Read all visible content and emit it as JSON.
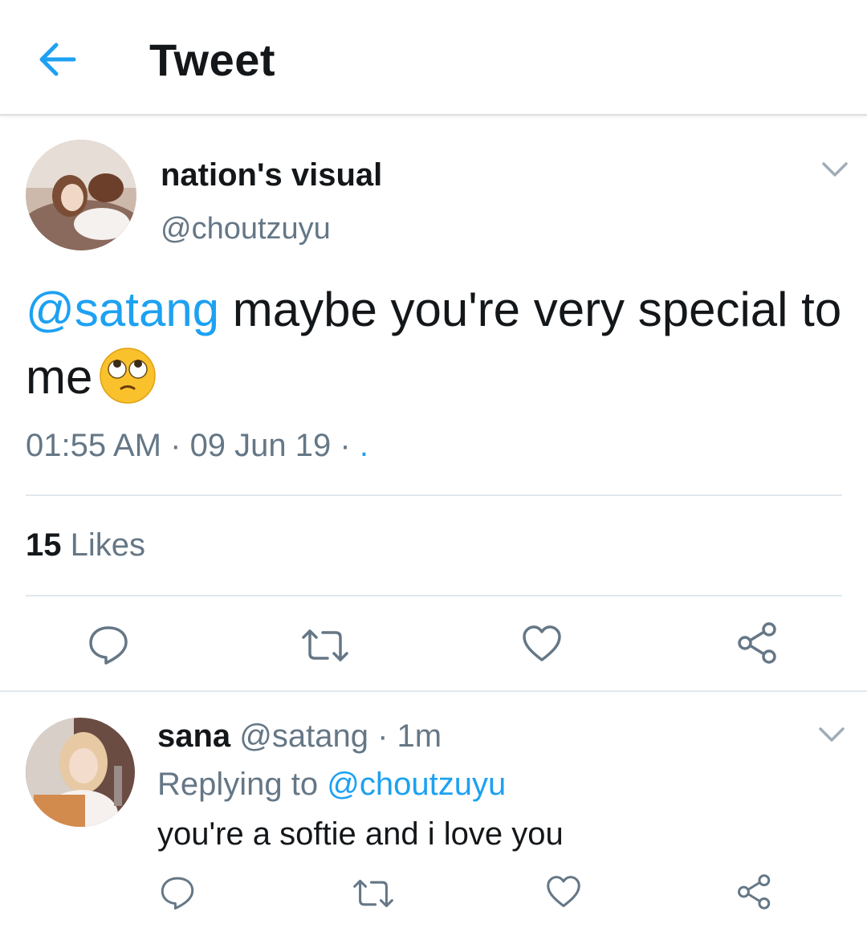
{
  "header": {
    "title": "Tweet",
    "back_icon": "arrow-left-icon"
  },
  "main_tweet": {
    "display_name": "nation's visual",
    "handle": "@choutzuyu",
    "mention": "@satang",
    "text": " maybe you're very special to me",
    "emoji": "face-with-rolling-eyes",
    "time": "01:55 AM",
    "sep1": " · ",
    "date": "09 Jun 19",
    "sep2": " · ",
    "source": ".",
    "likes_count": "15",
    "likes_label": " Likes"
  },
  "reply": {
    "display_name": "sana",
    "handle": "@satang",
    "age": " · 1m",
    "replying_label": "Replying to ",
    "replying_handle": "@choutzuyu",
    "text": "you're a softie and i love you"
  },
  "colors": {
    "accent": "#1da1f2",
    "muted": "#657786",
    "text": "#14171a",
    "icon": "#657786"
  }
}
